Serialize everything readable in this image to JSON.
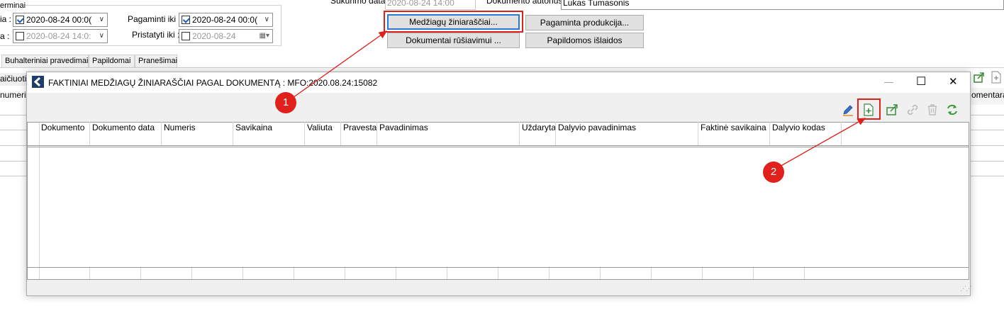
{
  "background_form": {
    "group_title": "erminai",
    "row1_label": "ia :",
    "row1_value": "2020-08-24 00:0(",
    "row2_label": "a :",
    "row2_value": "2020-08-24 14:0:",
    "pagaminti_label": "Pagaminti iki :",
    "pagaminti_value": "2020-08-24 00:0(",
    "pristatyti_label": "Pristatyti iki :",
    "pristatyti_value": "2020-08-24",
    "sukurimo_label": "Sukūrimo data :",
    "sukurimo_value": "2020-08-24 14:00",
    "autorius_label": "Dokumento autorius :",
    "autorius_value": "Lukas Tumasonis",
    "buttons": {
      "medziagu": "Medžiagų žiniaraščiai...",
      "pagaminta": "Pagaminta produkcija...",
      "rusiavimui": "Dokumentai rūšiavimui ...",
      "islaidos": "Papildomos išlaidos"
    },
    "tabs": [
      "Buhalteriniai pravedimai",
      "Papildomai",
      "Pranešimai"
    ],
    "left_partial_1": "aičiuoti",
    "left_partial_2": "numeri",
    "right_partial": "omentaras"
  },
  "dialog": {
    "title": "FAKTINIAI MEDŽIAGŲ ŽINIARAŠČIAI PAGAL DOKUMENTĄ : MFO:2020.08.24:15082",
    "minimize_glyph": "—",
    "maximize_glyph": "☐",
    "close_glyph": "✕",
    "columns": [
      "Dokumento",
      "Dokumento data",
      "Numeris",
      "Savikaina",
      "Valiuta",
      "Pravesta",
      "Pavadinimas",
      "Uždaryta",
      "Dalyvio pavadinimas",
      "Faktinė savikaina",
      "Dalyvio kodas"
    ]
  },
  "annotations": {
    "marker1": "1",
    "marker2": "2",
    "color": "#e0201b"
  },
  "icons": [
    "pencil-icon",
    "add-document-icon",
    "export-icon",
    "link-icon",
    "delete-icon",
    "refresh-icon"
  ]
}
